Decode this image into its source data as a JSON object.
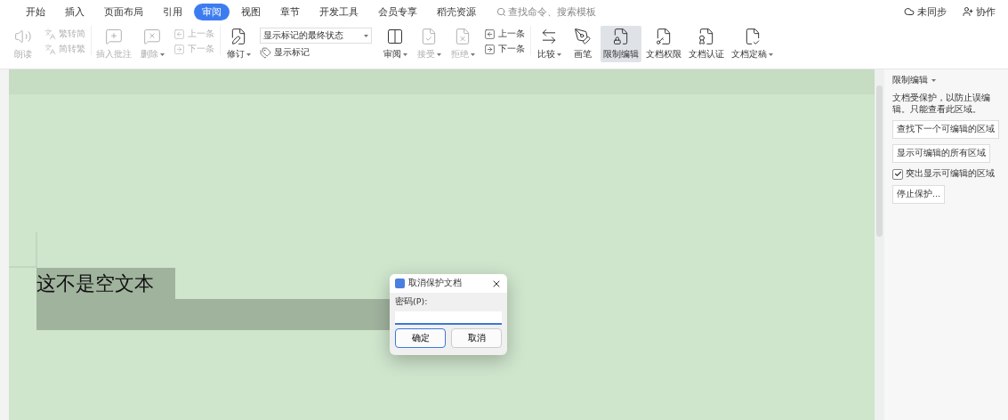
{
  "menu_tabs": [
    {
      "label": "开始",
      "selected": false
    },
    {
      "label": "插入",
      "selected": false
    },
    {
      "label": "页面布局",
      "selected": false
    },
    {
      "label": "引用",
      "selected": false
    },
    {
      "label": "审阅",
      "selected": true
    },
    {
      "label": "视图",
      "selected": false
    },
    {
      "label": "章节",
      "selected": false
    },
    {
      "label": "开发工具",
      "selected": false
    },
    {
      "label": "会员专享",
      "selected": false
    },
    {
      "label": "稻壳资源",
      "selected": false
    }
  ],
  "search": {
    "placeholder": "查找命令、搜索模板"
  },
  "top_right": [
    {
      "kind": "sync",
      "label": "未同步"
    },
    {
      "kind": "share",
      "label": "协作"
    }
  ],
  "ribbon": [
    {
      "kind": "big",
      "label": "朗读",
      "disabled": true,
      "caret": false,
      "selected": false
    },
    {
      "kind": "pair",
      "divider": true,
      "items": [
        {
          "label": "繁转简",
          "disabled": true
        },
        {
          "label": "简转繁",
          "disabled": true
        }
      ]
    },
    {
      "kind": "big",
      "label": "插入批注",
      "disabled": true,
      "caret": false,
      "selected": false
    },
    {
      "kind": "big",
      "label": "删除",
      "disabled": true,
      "caret": true,
      "selected": false
    },
    {
      "kind": "pair",
      "divider": true,
      "items": [
        {
          "label": "上一条",
          "disabled": true
        },
        {
          "label": "下一条",
          "disabled": true
        }
      ]
    },
    {
      "kind": "big",
      "label": "修订",
      "disabled": false,
      "caret": true,
      "selected": false
    },
    {
      "kind": "select",
      "value": "显示标记的最终状态",
      "item": {
        "label": "显示标记",
        "disabled": false
      }
    },
    {
      "kind": "big",
      "label": "审阅",
      "disabled": false,
      "caret": true,
      "selected": false
    },
    {
      "kind": "big",
      "label": "接受",
      "disabled": true,
      "caret": true,
      "selected": false
    },
    {
      "kind": "big",
      "label": "拒绝",
      "disabled": true,
      "caret": true,
      "selected": false
    },
    {
      "kind": "pair",
      "divider": true,
      "items": [
        {
          "label": "上一条",
          "disabled": false
        },
        {
          "label": "下一条",
          "disabled": false
        }
      ]
    },
    {
      "kind": "big",
      "label": "比较",
      "disabled": false,
      "caret": true,
      "selected": false
    },
    {
      "kind": "big",
      "label": "画笔",
      "disabled": false,
      "caret": false,
      "selected": false
    },
    {
      "kind": "big",
      "label": "限制编辑",
      "disabled": false,
      "caret": false,
      "selected": true
    },
    {
      "kind": "big",
      "label": "文档权限",
      "disabled": false,
      "caret": false,
      "selected": false
    },
    {
      "kind": "big",
      "label": "文档认证",
      "disabled": false,
      "caret": false,
      "selected": false
    },
    {
      "kind": "big",
      "label": "文档定稿",
      "disabled": false,
      "caret": true,
      "selected": false
    }
  ],
  "document": {
    "text": "这不是空文本"
  },
  "dialog": {
    "title": "取消保护文档",
    "field_label": "密码(P):",
    "buttons": [
      {
        "label": "确定",
        "selected": true
      },
      {
        "label": "取消",
        "selected": false
      }
    ]
  },
  "side_panel": {
    "title": "限制编辑",
    "description": "文档受保护，以防止误编辑。只能查看此区域。",
    "buttons": [
      "查找下一个可编辑的区域",
      "显示可编辑的所有区域"
    ],
    "checkbox": {
      "label": "突出显示可编辑的区域",
      "checked": true
    },
    "stop_button": "停止保护..."
  }
}
